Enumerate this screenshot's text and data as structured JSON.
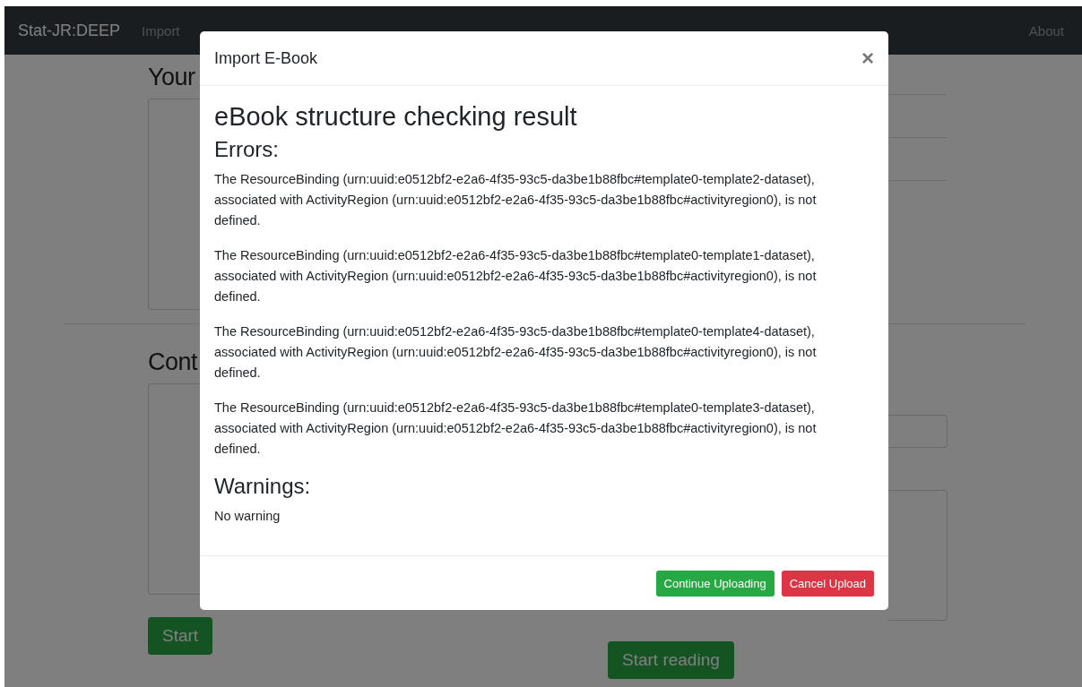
{
  "navbar": {
    "brand": "Stat-JR:DEEP",
    "links": [
      "Import"
    ],
    "right_link": "About"
  },
  "page": {
    "sections": [
      {
        "heading": "Your"
      },
      {
        "heading": "Cont",
        "button": "Start",
        "right_button": "Start reading"
      }
    ]
  },
  "modal": {
    "title": "Import E-Book",
    "close": "×",
    "heading": "eBook structure checking result",
    "errors_title": "Errors:",
    "errors": [
      "The ResourceBinding (urn:uuid:e0512bf2-e2a6-4f35-93c5-da3be1b88fbc#template0-template2-dataset), associated with ActivityRegion (urn:uuid:e0512bf2-e2a6-4f35-93c5-da3be1b88fbc#activityregion0), is not defined.",
      "The ResourceBinding (urn:uuid:e0512bf2-e2a6-4f35-93c5-da3be1b88fbc#template0-template1-dataset), associated with ActivityRegion (urn:uuid:e0512bf2-e2a6-4f35-93c5-da3be1b88fbc#activityregion0), is not defined.",
      "The ResourceBinding (urn:uuid:e0512bf2-e2a6-4f35-93c5-da3be1b88fbc#template0-template4-dataset), associated with ActivityRegion (urn:uuid:e0512bf2-e2a6-4f35-93c5-da3be1b88fbc#activityregion0), is not defined.",
      "The ResourceBinding (urn:uuid:e0512bf2-e2a6-4f35-93c5-da3be1b88fbc#template0-template3-dataset), associated with ActivityRegion (urn:uuid:e0512bf2-e2a6-4f35-93c5-da3be1b88fbc#activityregion0), is not defined."
    ],
    "warnings_title": "Warnings:",
    "warnings": [
      "No warning"
    ],
    "buttons": [
      {
        "label": "Continue Uploading",
        "kind": "success"
      },
      {
        "label": "Cancel Upload",
        "kind": "danger"
      }
    ]
  }
}
